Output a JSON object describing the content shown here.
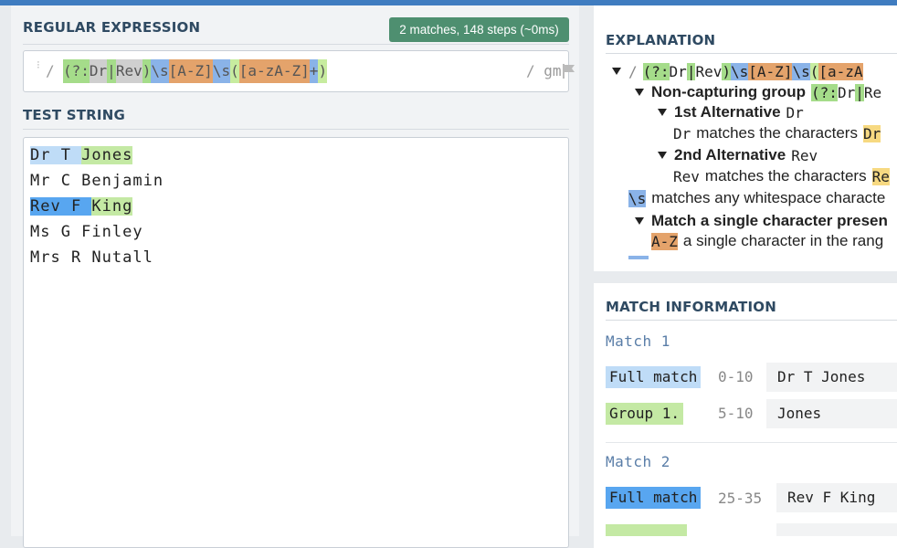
{
  "regex_section": {
    "title": "REGULAR EXPRESSION",
    "badge": "2 matches, 148 steps (~0ms)",
    "open_delim": "/",
    "tokens": [
      "(?:",
      "Dr",
      "|",
      "Rev",
      ")",
      "\\s",
      "[",
      "A-Z",
      "]",
      "\\s",
      "(",
      "[",
      "a-zA-Z",
      "]",
      "+",
      ")"
    ],
    "flags": "/ gm"
  },
  "test_section": {
    "title": "TEST STRING",
    "lines": [
      "Dr T Jones",
      "Mr C Benjamin",
      "Rev F King",
      "Ms G Finley",
      "Mrs R Nutall"
    ],
    "line1_match": "Dr T ",
    "line1_group": "Jones",
    "line3_match": "Rev F ",
    "line3_group": "King"
  },
  "explanation": {
    "title": "EXPLANATION",
    "root_delim": "/",
    "root_tokens": [
      "(?:",
      "Dr",
      "|",
      "Rev",
      ")",
      "\\s",
      "[",
      "A-Z",
      "]",
      "\\s",
      "(",
      "[",
      "a-zA"
    ],
    "noncap_label": "Non-capturing group",
    "noncap_tokens": [
      "(?:",
      "Dr",
      "|",
      "Re"
    ],
    "alt1_label": "1st Alternative",
    "alt1_token": "Dr",
    "alt1_desc_token": "Dr",
    "alt1_desc": "matches the characters",
    "alt1_desc_val": "Dr",
    "alt2_label": "2nd Alternative",
    "alt2_token": "Rev",
    "alt2_desc_token": "Rev",
    "alt2_desc": "matches the characters",
    "alt2_desc_val": "Re",
    "ws_token": "\\s",
    "ws_desc": "matches any whitespace characte",
    "set_label": "Match a single character presen",
    "range_token": "A-Z",
    "range_desc": "a single character in the rang"
  },
  "match_info": {
    "title": "MATCH INFORMATION",
    "matches": [
      {
        "label": "Match 1",
        "full_label": "Full match",
        "full_range": "0-10",
        "full_value": "Dr T Jones",
        "group_label": "Group 1.",
        "group_range": "5-10",
        "group_value": "Jones"
      },
      {
        "label": "Match 2",
        "full_label": "Full match",
        "full_range": "25-35",
        "full_value": "Rev F King"
      }
    ]
  },
  "colors": {
    "accent": "#3f7cc0",
    "badge": "#4e8f70",
    "title": "#2f4a62"
  }
}
